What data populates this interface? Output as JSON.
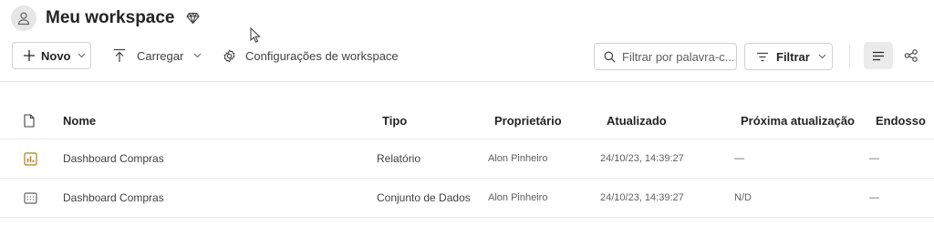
{
  "workspace": {
    "title": "Meu workspace",
    "avatar_icon": "person-icon",
    "premium_icon": "diamond-icon"
  },
  "toolbar": {
    "new_label": "Novo",
    "upload_label": "Carregar",
    "settings_label": "Configurações de workspace",
    "search_placeholder": "Filtrar por palavra-c...",
    "filter_label": "Filtrar"
  },
  "table": {
    "headers": {
      "name": "Nome",
      "type": "Tipo",
      "owner": "Proprietário",
      "updated": "Atualizado",
      "next_refresh": "Próxima atualização",
      "endorsement": "Endosso"
    },
    "rows": [
      {
        "icon": "report-icon",
        "name": "Dashboard Compras",
        "type": "Relatório",
        "owner": "Alon Pinheiro",
        "updated": "24/10/23, 14:39:27",
        "next_refresh": "—",
        "endorsement": "—"
      },
      {
        "icon": "dataset-icon",
        "name": "Dashboard Compras",
        "type": "Conjunto de Dados",
        "owner": "Alon Pinheiro",
        "updated": "24/10/23, 14:39:27",
        "next_refresh": "N/D",
        "endorsement": "—"
      }
    ]
  },
  "colors": {
    "report_icon": "#b07d1e",
    "border": "#d1d1d1",
    "text": "#242424"
  }
}
